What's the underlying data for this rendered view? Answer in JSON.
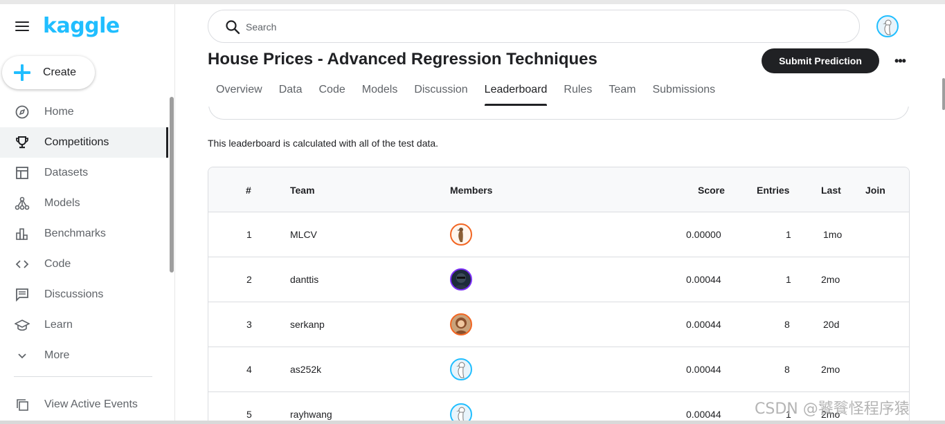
{
  "brand": {
    "logo_text": "kaggle",
    "accent": "#20beff"
  },
  "sidebar": {
    "create_label": "Create",
    "items": [
      {
        "label": "Home",
        "icon": "compass-icon",
        "active": false
      },
      {
        "label": "Competitions",
        "icon": "trophy-icon",
        "active": true
      },
      {
        "label": "Datasets",
        "icon": "table-icon",
        "active": false
      },
      {
        "label": "Models",
        "icon": "models-icon",
        "active": false
      },
      {
        "label": "Benchmarks",
        "icon": "bar-chart-icon",
        "active": false
      },
      {
        "label": "Code",
        "icon": "code-icon",
        "active": false
      },
      {
        "label": "Discussions",
        "icon": "discussion-icon",
        "active": false
      },
      {
        "label": "Learn",
        "icon": "graduation-cap-icon",
        "active": false
      },
      {
        "label": "More",
        "icon": "chevron-down-icon",
        "active": false
      }
    ],
    "events_label": "View Active Events"
  },
  "search": {
    "placeholder": "Search"
  },
  "competition": {
    "title": "House Prices - Advanced Regression Techniques",
    "submit_label": "Submit Prediction",
    "more_label": "•••",
    "tabs": [
      "Overview",
      "Data",
      "Code",
      "Models",
      "Discussion",
      "Leaderboard",
      "Rules",
      "Team",
      "Submissions"
    ],
    "active_tab": "Leaderboard"
  },
  "leaderboard": {
    "note": "This leaderboard is calculated with all of the test data.",
    "columns": {
      "rank": "#",
      "team": "Team",
      "members": "Members",
      "score": "Score",
      "entries": "Entries",
      "last": "Last",
      "join": "Join"
    },
    "rows": [
      {
        "rank": "1",
        "team": "MLCV",
        "score": "0.00000",
        "entries": "1",
        "last": "1mo",
        "avatar_color": "#f26522"
      },
      {
        "rank": "2",
        "team": "danttis",
        "score": "0.00044",
        "entries": "1",
        "last": "2mo",
        "avatar_color": "#7b2ff7"
      },
      {
        "rank": "3",
        "team": "serkanp",
        "score": "0.00044",
        "entries": "8",
        "last": "20d",
        "avatar_color": "#f26522"
      },
      {
        "rank": "4",
        "team": "as252k",
        "score": "0.00044",
        "entries": "8",
        "last": "2mo",
        "avatar_color": "#20beff"
      },
      {
        "rank": "5",
        "team": "rayhwang",
        "score": "0.00044",
        "entries": "1",
        "last": "2mo",
        "avatar_color": "#20beff"
      }
    ]
  },
  "watermark": "CSDN @饕餮怪程序猿"
}
